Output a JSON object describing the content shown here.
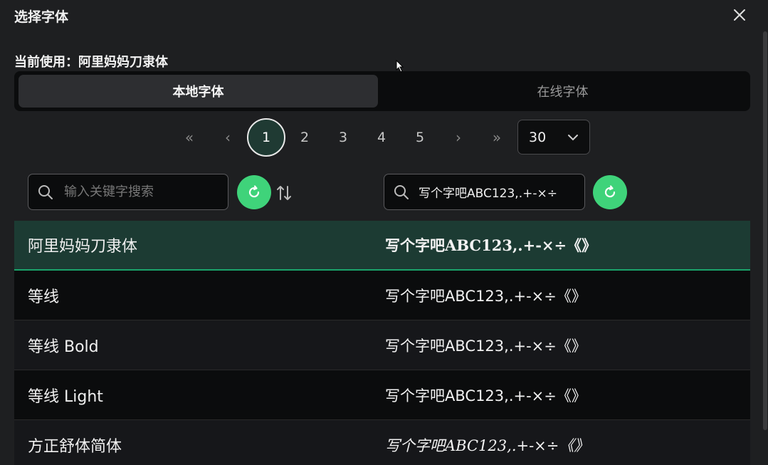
{
  "dialog": {
    "title": "选择字体",
    "current_label": "当前使用：阿里妈妈刀隶体"
  },
  "tabs": [
    {
      "label": "本地字体"
    },
    {
      "label": "在线字体"
    }
  ],
  "pagination": {
    "first": "«",
    "prev": "‹",
    "next": "›",
    "last": "»",
    "pages": [
      "1",
      "2",
      "3",
      "4",
      "5"
    ],
    "current": "1",
    "page_size": "30"
  },
  "search": {
    "placeholder": "输入关键字搜索",
    "value": ""
  },
  "preview": {
    "value": "写个字吧ABC123,.+-×÷"
  },
  "fonts": [
    {
      "name": "阿里妈妈刀隶体",
      "sample": "写个字吧ABC123,.+-×÷《》"
    },
    {
      "name": "等线",
      "sample": "写个字吧ABC123,.+-×÷《》"
    },
    {
      "name": "等线 Bold",
      "sample": "写个字吧ABC123,.+-×÷《》"
    },
    {
      "name": "等线 Light",
      "sample": "写个字吧ABC123,.+-×÷《》"
    },
    {
      "name": "方正舒体简体",
      "sample": "写个字吧ABC123,.+-×÷《》"
    }
  ],
  "colors": {
    "accent": "#3fd37a",
    "selected_row": "#1c3b33"
  },
  "icons": [
    "close-icon",
    "search-icon",
    "refresh-icon",
    "sort-icon",
    "chevron-down-icon"
  ]
}
